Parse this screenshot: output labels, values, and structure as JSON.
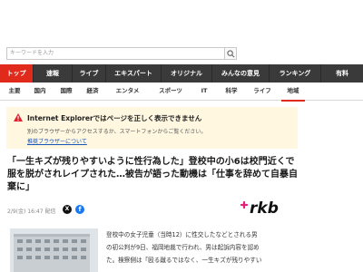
{
  "search": {
    "placeholder": "キーワードを入力"
  },
  "main_nav": [
    {
      "label": "トップ",
      "active": true
    },
    {
      "label": "速報",
      "active": false
    },
    {
      "label": "ライブ",
      "active": false
    },
    {
      "label": "エキスパート",
      "active": false
    },
    {
      "label": "オリジナル",
      "active": false
    },
    {
      "label": "みんなの意見",
      "active": false
    },
    {
      "label": "ランキング",
      "active": false
    },
    {
      "label": "有料",
      "active": false
    }
  ],
  "sub_nav": [
    {
      "label": "主要",
      "active": false
    },
    {
      "label": "国内",
      "active": false
    },
    {
      "label": "国際",
      "active": false
    },
    {
      "label": "経済",
      "active": false
    },
    {
      "label": "エンタメ",
      "active": false
    },
    {
      "label": "スポーツ",
      "active": false
    },
    {
      "label": "IT",
      "active": false
    },
    {
      "label": "科学",
      "active": false
    },
    {
      "label": "ライフ",
      "active": false
    },
    {
      "label": "地域",
      "active": true
    }
  ],
  "warning": {
    "title": "Internet Explorerではページを正しく表示できません",
    "body": "別のブラウザーからアクセスするか、スマートフォンからご覧ください。",
    "link": "推奨ブラウザーについて"
  },
  "article": {
    "title": "「一生キズが残りやすいように性行為した」登校中の小6は校門近くで服を脱がされレイプされた…被告が語った動機は「仕事を辞めて自暴自棄に」",
    "date": "2/9(金) 16:47 配信",
    "source_logo": "rkb",
    "body_lines": [
      "登校中の女子児童（当時12）に性交したなどとされる男",
      "の初公判が9日、福岡地裁で行われ、男は起訴内容を認め",
      "た。検察側は「殴る蹴るではなく、一生キズが残りやすい"
    ]
  },
  "colors": {
    "accent": "#e02a1c",
    "nav_bg": "#3a3a3a",
    "warning_bg": "#fff7e0",
    "link": "#1a56b8"
  }
}
